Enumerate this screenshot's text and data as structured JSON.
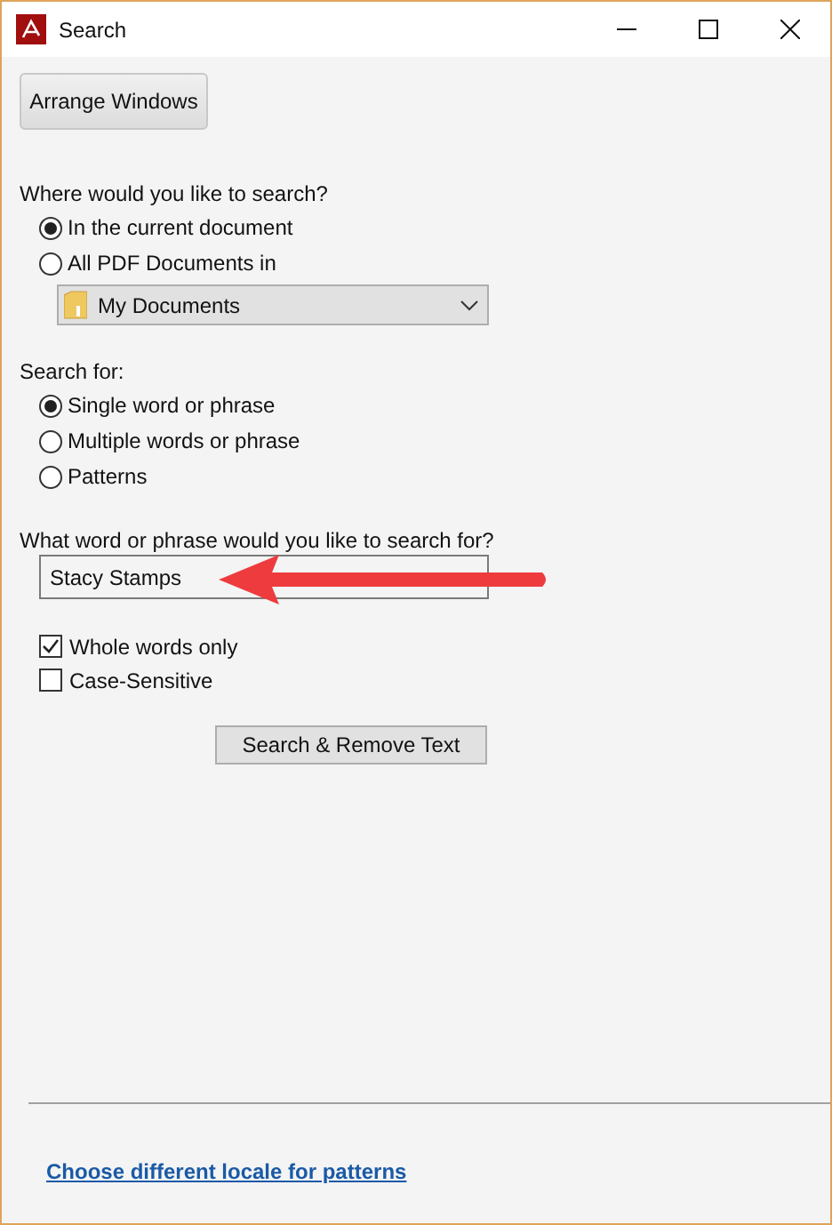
{
  "window": {
    "title": "Search"
  },
  "arrange_button": "Arrange Windows",
  "where": {
    "label": "Where would you like to search?",
    "options": [
      {
        "label": "In the current document",
        "selected": true
      },
      {
        "label": "All PDF Documents in",
        "selected": false
      }
    ],
    "folder": "My Documents"
  },
  "search_for": {
    "label": "Search for:",
    "options": [
      {
        "label": "Single word or phrase",
        "selected": true
      },
      {
        "label": "Multiple words or phrase",
        "selected": false
      },
      {
        "label": "Patterns",
        "selected": false
      }
    ]
  },
  "query": {
    "label": "What word or phrase would you like to search for?",
    "value": "Stacy Stamps"
  },
  "options": [
    {
      "label": "Whole words only",
      "checked": true
    },
    {
      "label": "Case-Sensitive",
      "checked": false
    }
  ],
  "action_button": "Search & Remove Text",
  "link": "Choose different locale for patterns"
}
